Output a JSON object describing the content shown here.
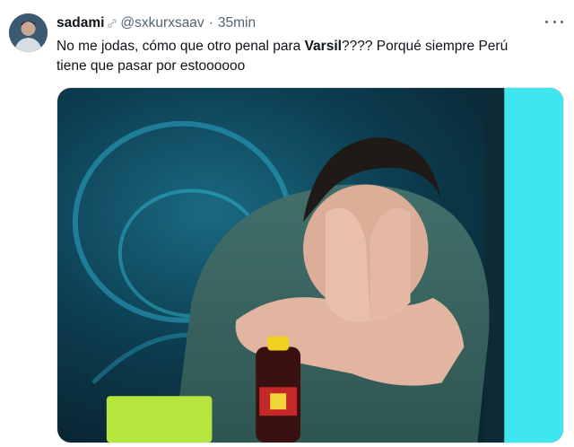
{
  "tweet": {
    "author_name": "sadami",
    "handle": "@sxkurxsaav",
    "separator": "·",
    "time": "35min",
    "text_before": "No me jodas, cómo que otro penal para ",
    "text_bold": "Varsil",
    "text_line1_after": "???? Porqué siempre Perú",
    "text_line2": "tiene que pasar por estoooooo"
  },
  "icons": {
    "more": "more-dots-icon",
    "link": "link-chain-icon"
  },
  "colors": {
    "text": "#0f1419",
    "secondary": "#536471",
    "screen_cyan": "#3fe6ef",
    "shirt": "#3b6a66",
    "backdrop": "#0d3a4a"
  }
}
